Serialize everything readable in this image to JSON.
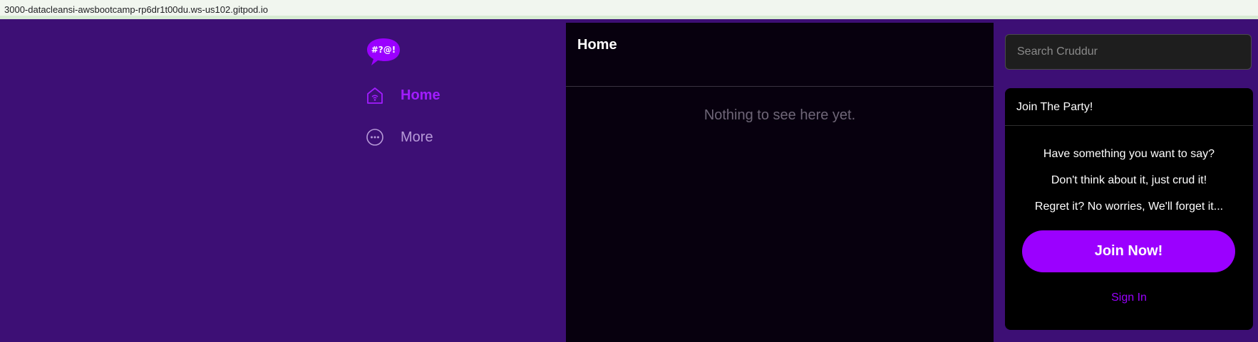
{
  "browser": {
    "url": "3000-datacleansi-awsbootcamp-rp6dr1t00du.ws-us102.gitpod.io"
  },
  "sidebar": {
    "logo_text": "#?@!",
    "items": [
      {
        "label": "Home",
        "icon": "home-icon",
        "active": true
      },
      {
        "label": "More",
        "icon": "more-dots-icon",
        "active": false
      }
    ]
  },
  "feed": {
    "title": "Home",
    "empty_message": "Nothing to see here yet."
  },
  "search": {
    "placeholder": "Search Cruddur",
    "value": ""
  },
  "join_card": {
    "title": "Join The Party!",
    "lines": [
      "Have something you want to say?",
      "Don't think about it, just crud it!",
      "Regret it? No worries, We'll forget it..."
    ],
    "join_label": "Join Now!",
    "signin_label": "Sign In"
  },
  "colors": {
    "accent": "#9b00ff",
    "sidebar_bg": "#3d0f75",
    "feed_bg": "#07000e"
  }
}
